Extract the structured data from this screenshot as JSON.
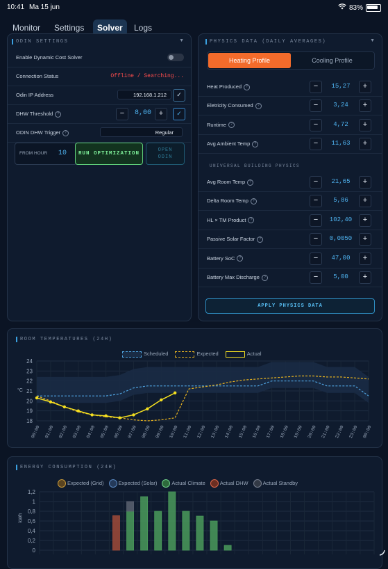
{
  "status_bar": {
    "time": "10:41",
    "date": "Ma 15 jun",
    "battery": "83%"
  },
  "nav": {
    "tabs": [
      "Monitor",
      "Settings",
      "Solver",
      "Logs"
    ],
    "active": "Solver"
  },
  "odin": {
    "title": "ODIN SETTINGS",
    "enable_label": "Enable Dynamic Cost Solver",
    "connection_label": "Connection Status",
    "connection_value": "Offline / Searching...",
    "ip_label": "Odin IP Address",
    "ip_value": "192.168.1.212",
    "dhw_label": "DHW Threshold",
    "dhw_value": "8,00",
    "trigger_label": "ODIN DHW Trigger",
    "trigger_value": "Regular",
    "from_hour_label": "FROM HOUR",
    "from_hour_value": "10",
    "run_button": "RUN OPTIMIZATION",
    "open_button_1": "OPEN",
    "open_button_2": "ODIN"
  },
  "physics": {
    "title": "PHYSICS DATA (DAILY AVERAGES)",
    "tab_heating": "Heating Profile",
    "tab_cooling": "Cooling Profile",
    "rows": [
      {
        "label": "Heat Produced",
        "value": "15,27"
      },
      {
        "label": "Eletricity Consumed",
        "value": "3,24"
      },
      {
        "label": "Runtime",
        "value": "4,72"
      },
      {
        "label": "Avg Ambient Temp",
        "value": "11,63"
      }
    ],
    "universal_title": "UNIVERSAL BUILDING PHYSICS",
    "universal_rows": [
      {
        "label": "Avg Room Temp",
        "value": "21,65"
      },
      {
        "label": "Delta Room Temp",
        "value": "5,86"
      },
      {
        "label": "HL × TM Product",
        "value": "102,40"
      },
      {
        "label": "Passive Solar Factor",
        "value": "0,0050"
      },
      {
        "label": "Battery SoC",
        "value": "47,00"
      },
      {
        "label": "Battery Max Discharge",
        "value": "5,00"
      }
    ],
    "apply_button": "APPLY PHYSICS DATA"
  },
  "room_chart": {
    "title": "ROOM TEMPERATURES (24H)",
    "legend": [
      "Scheduled",
      "Expected",
      "Actual"
    ],
    "ylabel": "°C"
  },
  "energy_chart": {
    "title": "ENERGY CONSUMPTION (24H)",
    "legend": [
      "Expected (Grid)",
      "Expected (Solar)",
      "Actual Climate",
      "Actual DHW",
      "Actual Standby"
    ],
    "ylabel": "kWh"
  },
  "chart_data": [
    {
      "type": "line",
      "title": "ROOM TEMPERATURES (24H)",
      "ylabel": "°C",
      "ylim": [
        18,
        24
      ],
      "x": [
        "00:00",
        "01:00",
        "02:00",
        "03:00",
        "04:00",
        "05:00",
        "06:00",
        "07:00",
        "08:00",
        "09:00",
        "10:00",
        "11:00",
        "12:00",
        "13:00",
        "14:00",
        "15:00",
        "16:00",
        "17:00",
        "18:00",
        "19:00",
        "20:00",
        "21:00",
        "22:00",
        "23:00",
        "00:00"
      ],
      "series": [
        {
          "name": "Scheduled",
          "values": [
            20.5,
            20.5,
            20.5,
            20.5,
            20.5,
            20.5,
            20.7,
            21.3,
            21.5,
            21.5,
            21.5,
            21.5,
            21.5,
            21.5,
            21.5,
            21.5,
            21.5,
            22.0,
            22.0,
            22.0,
            22.0,
            21.5,
            21.5,
            21.5,
            20.5
          ],
          "color": "#4fa3e0"
        },
        {
          "name": "Expected",
          "values": [
            20.5,
            20.0,
            19.4,
            18.9,
            18.6,
            18.4,
            18.3,
            18.1,
            18.0,
            18.1,
            18.3,
            21.2,
            21.4,
            21.6,
            21.9,
            22.1,
            22.2,
            22.3,
            22.4,
            22.5,
            22.5,
            22.4,
            22.4,
            22.3,
            22.2
          ],
          "color": "#e8b320"
        },
        {
          "name": "Actual",
          "values": [
            20.3,
            19.9,
            19.4,
            19.0,
            18.6,
            18.5,
            18.3,
            18.6,
            19.2,
            20.1,
            20.8
          ],
          "color": "#f5e020"
        }
      ],
      "band": {
        "low": [
          19.8,
          19.8,
          19.8,
          19.8,
          19.8,
          19.8,
          20.0,
          20.6,
          20.8,
          20.8,
          20.8,
          20.8,
          20.8,
          20.8,
          20.8,
          20.8,
          20.8,
          21.3,
          21.3,
          21.3,
          21.3,
          20.8,
          20.8,
          20.8,
          19.8
        ],
        "high": [
          22.4,
          22.4,
          22.4,
          22.4,
          22.4,
          22.4,
          22.6,
          23.2,
          23.4,
          23.4,
          23.4,
          23.4,
          23.4,
          23.4,
          23.4,
          23.4,
          23.4,
          23.9,
          23.9,
          23.9,
          23.9,
          23.4,
          23.4,
          23.4,
          22.4
        ]
      },
      "grid": true,
      "legend": "top-center"
    },
    {
      "type": "bar",
      "title": "ENERGY CONSUMPTION (24H)",
      "ylabel": "kWh",
      "ylim": [
        0,
        1.2
      ],
      "yticks": [
        "0",
        "0,2",
        "0,4",
        "0,6",
        "0,8",
        "1",
        "1,2"
      ],
      "bars": [
        {
          "slot": 5,
          "series": "Actual DHW",
          "value": 0.71
        },
        {
          "slot": 6,
          "series": "Actual Climate",
          "value": 0.8
        },
        {
          "slot": 6,
          "series": "Actual Standby",
          "value": 0.2
        },
        {
          "slot": 7,
          "series": "Actual Climate",
          "value": 1.1
        },
        {
          "slot": 8,
          "series": "Actual Climate",
          "value": 0.8
        },
        {
          "slot": 9,
          "series": "Actual Climate",
          "value": 1.2
        },
        {
          "slot": 10,
          "series": "Actual Climate",
          "value": 0.8
        },
        {
          "slot": 11,
          "series": "Actual Climate",
          "value": 0.7
        },
        {
          "slot": 12,
          "series": "Actual Climate",
          "value": 0.6
        },
        {
          "slot": 13,
          "series": "Actual Climate",
          "value": 0.1
        }
      ],
      "colors": {
        "Expected (Grid)": "#8a6a2a",
        "Expected (Solar)": "#3a5e8a",
        "Actual Climate": "#4a9a5a",
        "Actual DHW": "#a04a38",
        "Actual Standby": "#5a6170"
      },
      "legend": "top-center"
    }
  ]
}
